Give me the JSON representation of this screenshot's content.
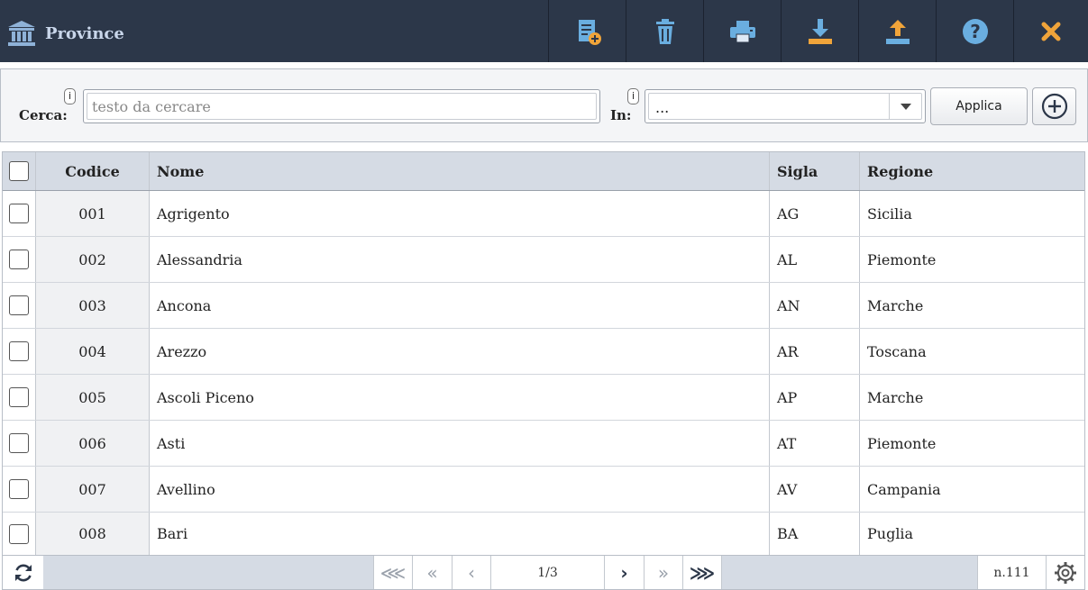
{
  "header": {
    "title": "Province",
    "title_icon": "institution-icon",
    "toolbar": [
      {
        "name": "new-document-button",
        "icon": "new-document-icon"
      },
      {
        "name": "delete-button",
        "icon": "trash-icon"
      },
      {
        "name": "print-button",
        "icon": "printer-icon"
      },
      {
        "name": "download-button",
        "icon": "download-icon"
      },
      {
        "name": "upload-button",
        "icon": "upload-icon"
      },
      {
        "name": "help-button",
        "icon": "help-icon"
      },
      {
        "name": "close-button",
        "icon": "close-icon"
      }
    ]
  },
  "search": {
    "cerca_label": "Cerca:",
    "in_label": "In:",
    "info_glyph": "i",
    "placeholder": "testo da cercare",
    "value": "",
    "in_value": "...",
    "apply_label": "Applica"
  },
  "table": {
    "columns": [
      "Codice",
      "Nome",
      "Sigla",
      "Regione"
    ],
    "rows": [
      {
        "codice": "001",
        "nome": "Agrigento",
        "sigla": "AG",
        "regione": "Sicilia"
      },
      {
        "codice": "002",
        "nome": "Alessandria",
        "sigla": "AL",
        "regione": "Piemonte"
      },
      {
        "codice": "003",
        "nome": "Ancona",
        "sigla": "AN",
        "regione": "Marche"
      },
      {
        "codice": "004",
        "nome": "Arezzo",
        "sigla": "AR",
        "regione": "Toscana"
      },
      {
        "codice": "005",
        "nome": "Ascoli Piceno",
        "sigla": "AP",
        "regione": "Marche"
      },
      {
        "codice": "006",
        "nome": "Asti",
        "sigla": "AT",
        "regione": "Piemonte"
      },
      {
        "codice": "007",
        "nome": "Avellino",
        "sigla": "AV",
        "regione": "Campania"
      },
      {
        "codice": "008",
        "nome": "Bari",
        "sigla": "BA",
        "regione": "Puglia"
      }
    ]
  },
  "pager": {
    "page": "1/3",
    "count": "n.111",
    "first": "⋘",
    "prev_group": "«",
    "prev": "‹",
    "next": "›",
    "next_group": "»",
    "last": "⋙"
  },
  "colors": {
    "header_bg": "#2c3749",
    "icon_blue": "#6aaee0",
    "icon_orange": "#f0a43a",
    "grid_header_bg": "#d5dbe4"
  }
}
